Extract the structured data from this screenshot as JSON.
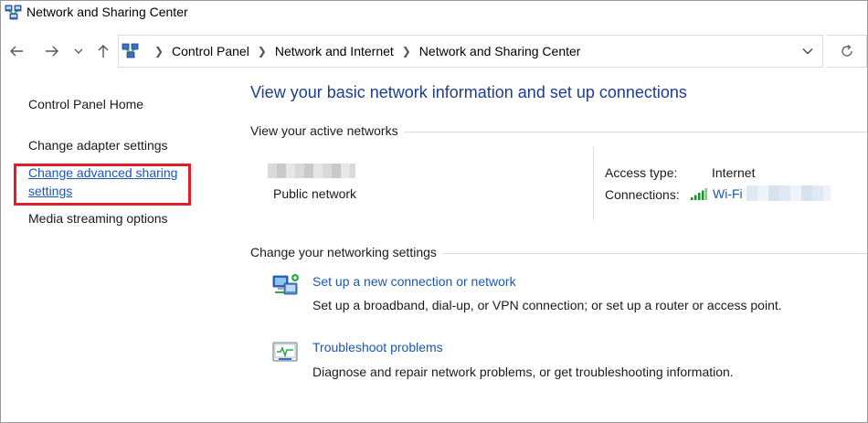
{
  "window": {
    "title": "Network and Sharing Center",
    "icon": "network-center-icon"
  },
  "nav": {
    "back_icon": "back-arrow-icon",
    "forward_icon": "forward-arrow-icon",
    "recent_icon": "chevron-down-icon",
    "up_icon": "up-arrow-icon",
    "refresh_icon": "refresh-icon"
  },
  "address": {
    "crumbs": [
      "Control Panel",
      "Network and Internet",
      "Network and Sharing Center"
    ]
  },
  "sidebar": {
    "items": [
      {
        "label": "Control Panel Home"
      },
      {
        "label": "Change adapter settings"
      },
      {
        "label_line1": "Change advanced sharing",
        "label_line2": "settings"
      },
      {
        "label": "Media streaming options"
      }
    ]
  },
  "main": {
    "title": "View your basic network information and set up connections",
    "active_networks": {
      "heading": "View your active networks",
      "network_type": "Public network",
      "access_type_label": "Access type:",
      "access_type_value": "Internet",
      "connections_label": "Connections:",
      "connection_name": "Wi-Fi"
    },
    "change_settings": {
      "heading": "Change your networking settings",
      "tasks": [
        {
          "link": "Set up a new connection or network",
          "description": "Set up a broadband, dial-up, or VPN connection; or set up a router or access point.",
          "icon": "new-connection-icon"
        },
        {
          "link": "Troubleshoot problems",
          "description": "Diagnose and repair network problems, or get troubleshooting information.",
          "icon": "troubleshoot-icon"
        }
      ]
    }
  },
  "colors": {
    "heading_blue": "#1e3d8f",
    "link_blue": "#1a56b8",
    "highlight_red": "#e11d2a"
  }
}
